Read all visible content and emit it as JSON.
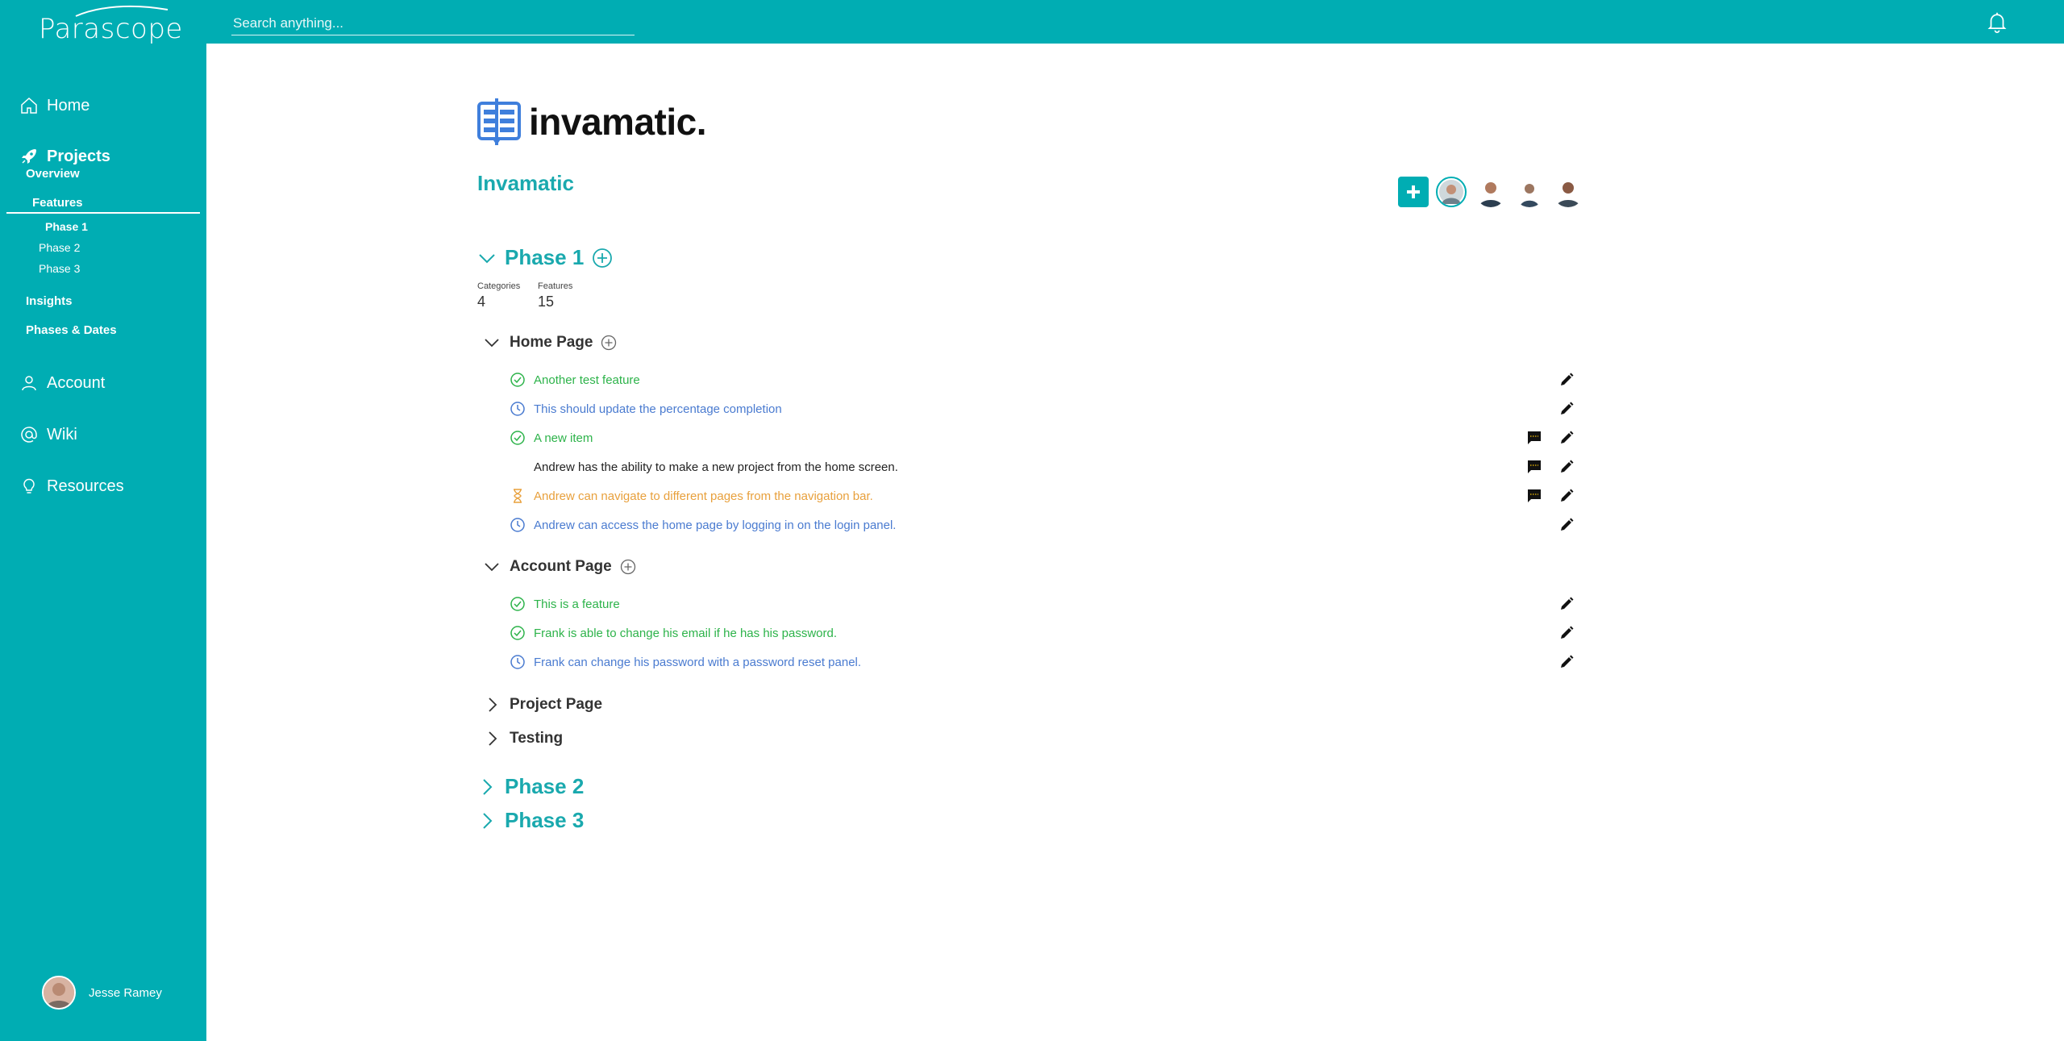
{
  "app": {
    "brand": "Parascope",
    "search_placeholder": "Search anything..."
  },
  "sidebar": {
    "nav": [
      {
        "label": "Home",
        "icon": "home-icon"
      },
      {
        "label": "Projects",
        "icon": "rocket-icon"
      },
      {
        "label": "Account",
        "icon": "user-icon"
      },
      {
        "label": "Wiki",
        "icon": "at-icon"
      },
      {
        "label": "Resources",
        "icon": "lightbulb-icon"
      }
    ],
    "projects_sub": [
      "Overview",
      "Features",
      "Insights",
      "Phases & Dates"
    ],
    "phases_sub": [
      "Phase 1",
      "Phase 2",
      "Phase 3"
    ],
    "user": "Jesse Ramey"
  },
  "project": {
    "logo_text": "invamatic.",
    "title": "Invamatic"
  },
  "phase1": {
    "label": "Phase 1",
    "stats": {
      "categories_label": "Categories",
      "categories": "4",
      "features_label": "Features",
      "features": "15"
    },
    "categories": [
      {
        "label": "Home Page",
        "features": [
          {
            "text": "Another test feature",
            "status": "done"
          },
          {
            "text": "This should update the percentage completion",
            "status": "pending"
          },
          {
            "text": "A new item",
            "status": "done"
          },
          {
            "text": "Andrew has the ability to make a new project from the home screen.",
            "status": "none"
          },
          {
            "text": "Andrew can navigate to different pages from the navigation bar.",
            "status": "in-progress"
          },
          {
            "text": "Andrew can access the home page by logging in on the login panel.",
            "status": "pending"
          }
        ]
      },
      {
        "label": "Account Page",
        "features": [
          {
            "text": "This is a feature",
            "status": "done"
          },
          {
            "text": "Frank is able to change his email if he has his password.",
            "status": "done"
          },
          {
            "text": "Frank can change his password with a password reset panel.",
            "status": "pending"
          }
        ]
      },
      {
        "label": "Project Page"
      },
      {
        "label": "Testing"
      }
    ]
  },
  "other_phases": [
    "Phase 2",
    "Phase 3"
  ],
  "colors": {
    "accent": "#00adb3",
    "done": "#2db34a",
    "pending": "#4a7bd0",
    "in_progress": "#e8a03c"
  }
}
